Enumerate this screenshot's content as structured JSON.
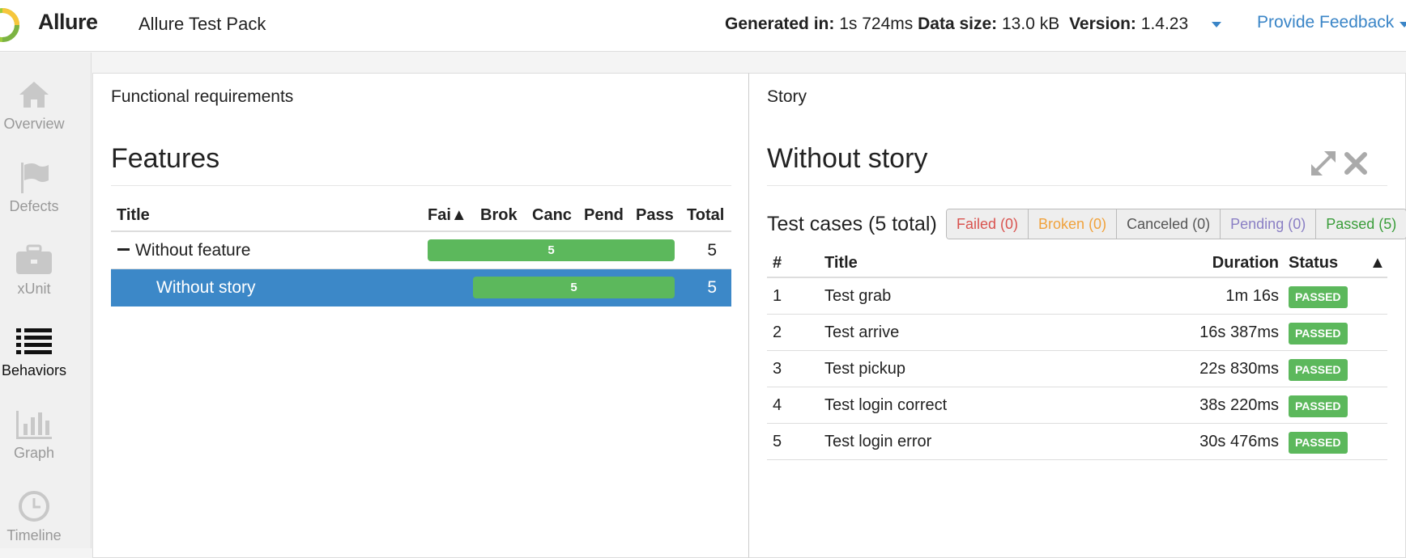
{
  "header": {
    "brand": "Allure",
    "pack_title": "Allure Test Pack",
    "generated_label": "Generated in:",
    "generated_value": "1s 724ms",
    "data_size_label": "Data size:",
    "data_size_value": "13.0 kB",
    "version_label": "Version:",
    "version_value": "1.4.23",
    "feedback": "Provide Feedback"
  },
  "sidebar": {
    "items": [
      {
        "label": "Overview",
        "icon": "home-icon",
        "active": false
      },
      {
        "label": "Defects",
        "icon": "flag-icon",
        "active": false
      },
      {
        "label": "xUnit",
        "icon": "briefcase-icon",
        "active": false
      },
      {
        "label": "Behaviors",
        "icon": "list-icon",
        "active": true
      },
      {
        "label": "Graph",
        "icon": "bar-chart-icon",
        "active": false
      },
      {
        "label": "Timeline",
        "icon": "clock-icon",
        "active": false
      }
    ]
  },
  "left": {
    "header": "Functional requirements",
    "title": "Features",
    "columns": [
      "Title",
      "Fai▲",
      "Brok",
      "Canc",
      "Pend",
      "Pass",
      "Total"
    ],
    "rows": [
      {
        "title": "Without feature",
        "bar": "5",
        "total": "5"
      },
      {
        "title": "Without story",
        "bar": "5",
        "total": "5"
      }
    ]
  },
  "right": {
    "header": "Story",
    "title": "Without story",
    "test_cases_heading": "Test cases (5 total)",
    "filters": [
      {
        "label": "Failed (0)",
        "color": "#d9534f"
      },
      {
        "label": "Broken (0)",
        "color": "#f0a23c"
      },
      {
        "label": "Canceled (0)",
        "color": "#555555"
      },
      {
        "label": "Pending (0)",
        "color": "#8a7fc4"
      },
      {
        "label": "Passed (5)",
        "color": "#3a9d3a"
      }
    ],
    "columns": {
      "num": "#",
      "title": "Title",
      "duration": "Duration",
      "status": "Status",
      "sort": "▲"
    },
    "rows": [
      {
        "num": "1",
        "title": "Test grab",
        "duration": "1m 16s",
        "status": "PASSED"
      },
      {
        "num": "2",
        "title": "Test arrive",
        "duration": "16s 387ms",
        "status": "PASSED"
      },
      {
        "num": "3",
        "title": "Test pickup",
        "duration": "22s 830ms",
        "status": "PASSED"
      },
      {
        "num": "4",
        "title": "Test login correct",
        "duration": "38s 220ms",
        "status": "PASSED"
      },
      {
        "num": "5",
        "title": "Test login error",
        "duration": "30s 476ms",
        "status": "PASSED"
      }
    ]
  },
  "colors": {
    "accent": "#3c88c8",
    "passed": "#5cb85c"
  }
}
